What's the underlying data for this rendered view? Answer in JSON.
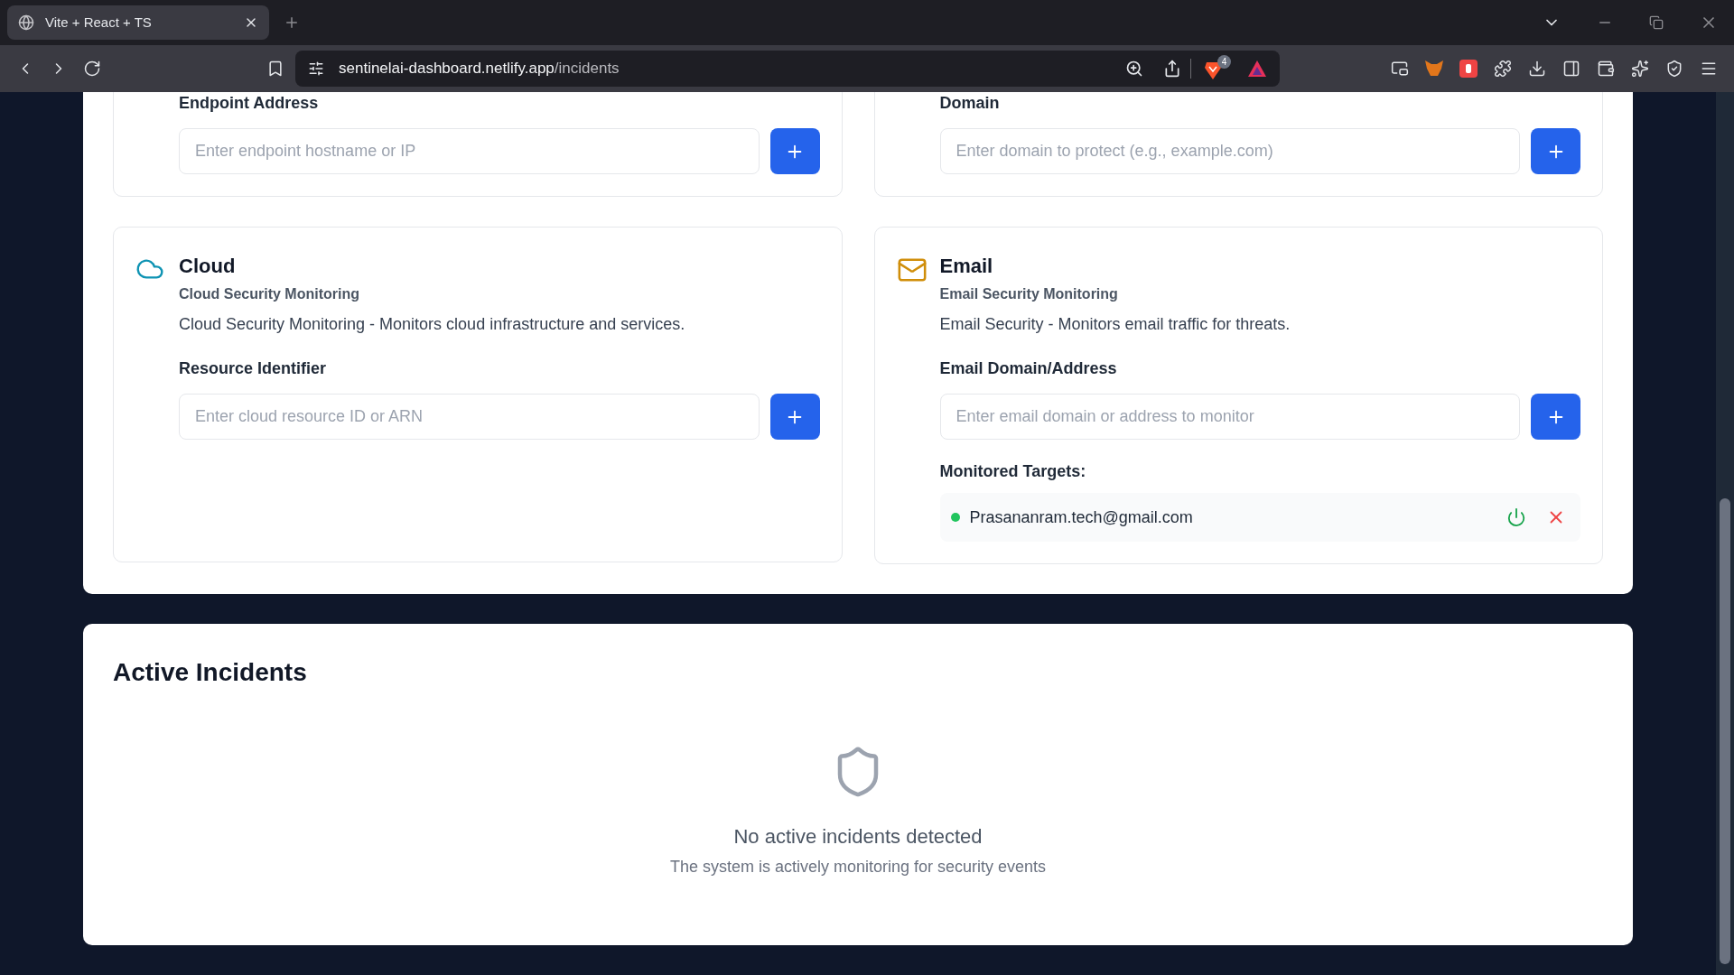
{
  "browser": {
    "tabs": [
      {
        "title": "Vite + React + TS",
        "selected": true
      }
    ],
    "url": {
      "domain": "sentinelai-dashboard.netlify.app",
      "path": "/incidents"
    },
    "shields_badge": "4"
  },
  "monitors": [
    {
      "field_label": "Endpoint Address",
      "placeholder": "Enter endpoint hostname or IP"
    },
    {
      "field_label": "Domain",
      "placeholder": "Enter domain to protect (e.g., example.com)"
    },
    {
      "kind": "cloud",
      "title": "Cloud",
      "subtitle": "Cloud Security Monitoring",
      "description": "Cloud Security Monitoring - Monitors cloud infrastructure and services.",
      "field_label": "Resource Identifier",
      "placeholder": "Enter cloud resource ID or ARN"
    },
    {
      "kind": "email",
      "title": "Email",
      "subtitle": "Email Security Monitoring",
      "description": "Email Security - Monitors email traffic for threats.",
      "field_label": "Email Domain/Address",
      "placeholder": "Enter email domain or address to monitor",
      "targets_label": "Monitored Targets:",
      "targets": [
        {
          "address": "Prasananram.tech@gmail.com",
          "color": "#22c55e"
        }
      ]
    }
  ],
  "incidents": {
    "title": "Active Incidents",
    "empty_title": "No active incidents detected",
    "empty_subtitle": "The system is actively monitoring for security events"
  }
}
